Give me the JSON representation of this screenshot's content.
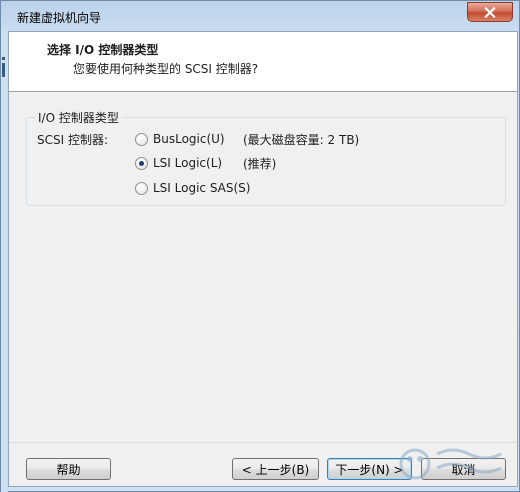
{
  "window": {
    "title": "新建虚拟机向导"
  },
  "header": {
    "title": "选择 I/O 控制器类型",
    "subtitle": "您要使用何种类型的 SCSI 控制器?"
  },
  "group": {
    "label": "I/O 控制器类型",
    "field_label": "SCSI 控制器:",
    "options": [
      {
        "label": "BusLogic(U)",
        "note": "(最大磁盘容量: 2 TB)",
        "checked": false
      },
      {
        "label": "LSI Logic(L)",
        "note": "(推荐)",
        "checked": true
      },
      {
        "label": "LSI Logic SAS(S)",
        "note": "",
        "checked": false
      }
    ]
  },
  "buttons": {
    "help": "帮助",
    "back": "< 上一步(B)",
    "next": "下一步(N) >",
    "cancel": "取消"
  },
  "colors": {
    "title_bar": "#c9dcf0",
    "close_button": "#c34a2f",
    "dialog_bg": "#f0f0f0",
    "default_button_border": "#3c7fb1"
  }
}
